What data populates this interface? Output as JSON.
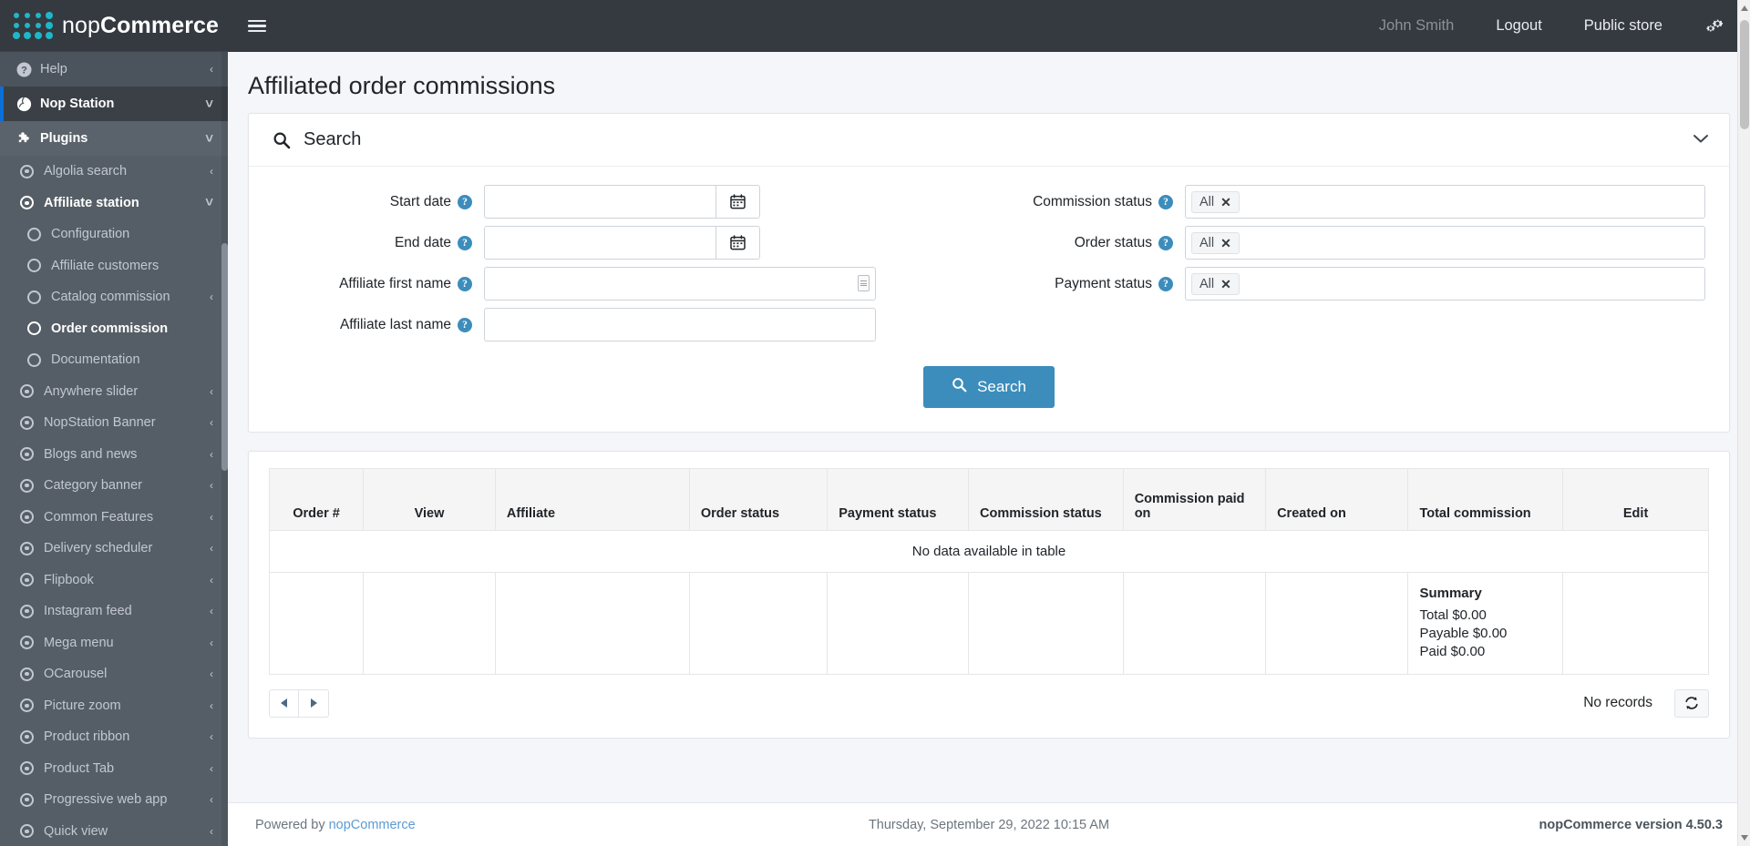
{
  "brand": {
    "name_light": "nop",
    "name_bold": "Commerce"
  },
  "topbar": {
    "menu_toggle_icon": "hamburger-icon",
    "user_name": "John Smith",
    "logout_label": "Logout",
    "public_store_label": "Public store",
    "settings_icon": "gears-icon"
  },
  "sidebar": {
    "items": [
      {
        "label": "Help",
        "icon": "question-circle-icon",
        "level": 0,
        "caret": "‹",
        "style": "plain"
      },
      {
        "label": "Nop Station",
        "icon": "globe-icon",
        "level": 0,
        "caret": "˅",
        "style": "active"
      },
      {
        "label": "Plugins",
        "icon": "puzzle-icon",
        "level": 0,
        "caret": "˅",
        "style": "plugins"
      },
      {
        "label": "Algolia search",
        "icon": "radio-dot-icon",
        "level": 1,
        "caret": "‹",
        "style": "sub"
      },
      {
        "label": "Affiliate station",
        "icon": "radio-dot-icon",
        "level": 1,
        "caret": "˅",
        "style": "sub-bold"
      },
      {
        "label": "Configuration",
        "icon": "circle-icon",
        "level": 2,
        "caret": "",
        "style": "sub2"
      },
      {
        "label": "Affiliate customers",
        "icon": "circle-icon",
        "level": 2,
        "caret": "",
        "style": "sub2"
      },
      {
        "label": "Catalog commission",
        "icon": "circle-icon",
        "level": 2,
        "caret": "‹",
        "style": "sub2"
      },
      {
        "label": "Order commission",
        "icon": "circle-icon",
        "level": 2,
        "caret": "",
        "style": "sub2-bold"
      },
      {
        "label": "Documentation",
        "icon": "circle-icon",
        "level": 2,
        "caret": "",
        "style": "sub2"
      },
      {
        "label": "Anywhere slider",
        "icon": "radio-dot-icon",
        "level": 1,
        "caret": "‹",
        "style": "sub"
      },
      {
        "label": "NopStation Banner",
        "icon": "radio-dot-icon",
        "level": 1,
        "caret": "‹",
        "style": "sub"
      },
      {
        "label": "Blogs and news",
        "icon": "radio-dot-icon",
        "level": 1,
        "caret": "‹",
        "style": "sub"
      },
      {
        "label": "Category banner",
        "icon": "radio-dot-icon",
        "level": 1,
        "caret": "‹",
        "style": "sub"
      },
      {
        "label": "Common Features",
        "icon": "radio-dot-icon",
        "level": 1,
        "caret": "‹",
        "style": "sub"
      },
      {
        "label": "Delivery scheduler",
        "icon": "radio-dot-icon",
        "level": 1,
        "caret": "‹",
        "style": "sub"
      },
      {
        "label": "Flipbook",
        "icon": "radio-dot-icon",
        "level": 1,
        "caret": "‹",
        "style": "sub"
      },
      {
        "label": "Instagram feed",
        "icon": "radio-dot-icon",
        "level": 1,
        "caret": "‹",
        "style": "sub"
      },
      {
        "label": "Mega menu",
        "icon": "radio-dot-icon",
        "level": 1,
        "caret": "‹",
        "style": "sub"
      },
      {
        "label": "OCarousel",
        "icon": "radio-dot-icon",
        "level": 1,
        "caret": "‹",
        "style": "sub"
      },
      {
        "label": "Picture zoom",
        "icon": "radio-dot-icon",
        "level": 1,
        "caret": "‹",
        "style": "sub"
      },
      {
        "label": "Product ribbon",
        "icon": "radio-dot-icon",
        "level": 1,
        "caret": "‹",
        "style": "sub"
      },
      {
        "label": "Product Tab",
        "icon": "radio-dot-icon",
        "level": 1,
        "caret": "‹",
        "style": "sub"
      },
      {
        "label": "Progressive web app",
        "icon": "radio-dot-icon",
        "level": 1,
        "caret": "‹",
        "style": "sub"
      },
      {
        "label": "Quick view",
        "icon": "radio-dot-icon",
        "level": 1,
        "caret": "‹",
        "style": "sub"
      }
    ]
  },
  "page": {
    "title": "Affiliated order commissions"
  },
  "search_panel": {
    "title": "Search",
    "search_icon": "magnifier-icon",
    "collapse_icon": "chevron-down-icon",
    "fields": {
      "start_date": {
        "label": "Start date",
        "value": "",
        "placeholder": "",
        "help": "?",
        "addon_icon": "calendar-icon"
      },
      "end_date": {
        "label": "End date",
        "value": "",
        "placeholder": "",
        "help": "?",
        "addon_icon": "calendar-icon"
      },
      "affiliate_first_name": {
        "label": "Affiliate first name",
        "value": "",
        "placeholder": "",
        "help": "?"
      },
      "affiliate_last_name": {
        "label": "Affiliate last name",
        "value": "",
        "placeholder": "",
        "help": "?"
      },
      "commission_status": {
        "label": "Commission status",
        "help": "?",
        "tags": [
          "All"
        ]
      },
      "order_status": {
        "label": "Order status",
        "help": "?",
        "tags": [
          "All"
        ]
      },
      "payment_status": {
        "label": "Payment status",
        "help": "?",
        "tags": [
          "All"
        ]
      }
    },
    "search_button": {
      "label": "Search",
      "icon": "magnifier-icon",
      "color": "#3c8dbc"
    }
  },
  "table": {
    "columns": [
      "Order #",
      "View",
      "Affiliate",
      "Order status",
      "Payment status",
      "Commission status",
      "Commission paid on",
      "Created on",
      "Total commission",
      "Edit"
    ],
    "empty_message": "No data available in table",
    "summary": {
      "title": "Summary",
      "total": "Total $0.00",
      "payable": "Payable $0.00",
      "paid": "Paid $0.00"
    },
    "pager": {
      "prev_icon": "triangle-left-icon",
      "next_icon": "triangle-right-icon"
    },
    "records_label": "No records",
    "refresh_icon": "refresh-icon"
  },
  "footer": {
    "powered_by": "Powered by ",
    "powered_link": "nopCommerce",
    "datetime": "Thursday, September 29, 2022 10:15 AM",
    "version": "nopCommerce version 4.50.3"
  }
}
